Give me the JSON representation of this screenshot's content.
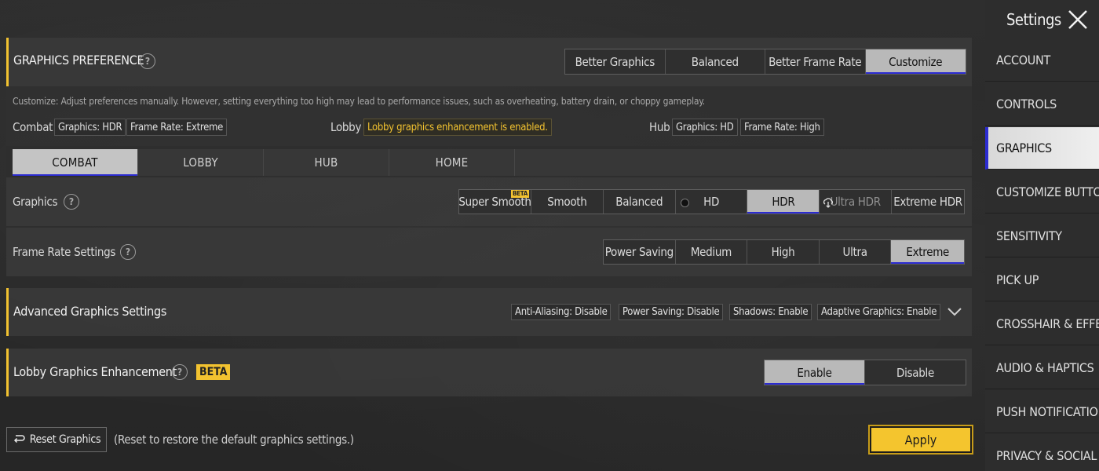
{
  "preference": {
    "title": "GRAPHICS PREFERENCE",
    "help": "?",
    "options": [
      "Better Graphics",
      "Balanced",
      "Better Frame Rate",
      "Customize"
    ],
    "selected": "Customize"
  },
  "description": "Customize: Adjust preferences manually. However, setting everything too high may lead to performance issues, such as overheating, battery drain, or choppy gameplay.",
  "summary": {
    "combat_label": "Combat",
    "combat_graphics": "Graphics: HDR",
    "combat_framerate": "Frame Rate: Extreme",
    "lobby_label": "Lobby",
    "lobby_note": "Lobby graphics enhancement is enabled.",
    "hub_label": "Hub",
    "hub_graphics": "Graphics: HD",
    "hub_framerate": "Frame Rate: High"
  },
  "tabs": [
    "COMBAT",
    "LOBBY",
    "HUB",
    "HOME"
  ],
  "graphics": {
    "label": "Graphics",
    "options": [
      "Super Smooth",
      "Smooth",
      "Balanced",
      "HD",
      "HDR",
      "Ultra HDR",
      "Extreme HDR"
    ],
    "beta": "BETA",
    "selected": "HDR"
  },
  "framerate": {
    "label": "Frame Rate Settings",
    "options": [
      "Power Saving",
      "Medium",
      "High",
      "Ultra",
      "Extreme"
    ],
    "selected": "Extreme"
  },
  "advanced": {
    "label": "Advanced Graphics Settings",
    "tags": [
      "Anti-Aliasing: Disable",
      "Power Saving: Disable",
      "Shadows: Enable",
      "Adaptive Graphics: Enable"
    ]
  },
  "lobby_enh": {
    "label": "Lobby Graphics Enhancement",
    "beta": "BETA",
    "options": [
      "Enable",
      "Disable"
    ],
    "selected": "Enable"
  },
  "footer": {
    "reset_label": "Reset Graphics",
    "reset_note": "(Reset to restore the default graphics settings.)",
    "apply_label": "Apply"
  },
  "nav": {
    "title": "Settings",
    "items": [
      "ACCOUNT",
      "CONTROLS",
      "GRAPHICS",
      "CUSTOMIZE BUTTONS",
      "SENSITIVITY",
      "PICK UP",
      "CROSSHAIR & EFFECTS",
      "AUDIO & HAPTICS",
      "PUSH NOTIFICATIONS",
      "PRIVACY & SOCIAL"
    ],
    "selected": "GRAPHICS"
  },
  "colors": {
    "accent": "#f2c230",
    "selected_underline": "#2b2bd1",
    "selected_bg": "#b9b9b9"
  }
}
